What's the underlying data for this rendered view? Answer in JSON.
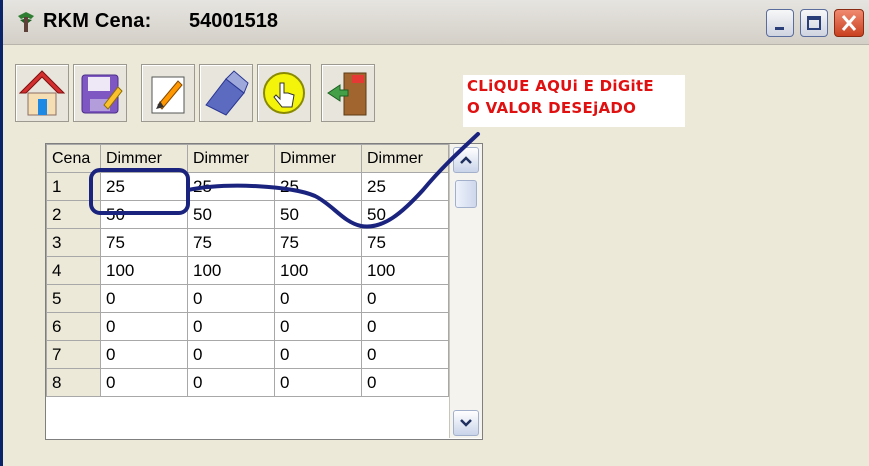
{
  "window": {
    "title_label": "RKM Cena:",
    "title_value": "54001518",
    "controls": [
      "minimize-icon",
      "maximize-icon",
      "close-icon"
    ]
  },
  "toolbar": {
    "buttons": [
      "home-icon",
      "save-icon",
      "edit-icon",
      "clear-icon",
      "click-icon",
      "exit-icon"
    ]
  },
  "callout": {
    "line1": "CLiQUE AQUi E DiGitE",
    "line2": "O VALOR DESEjADO",
    "color": "#e01010"
  },
  "grid": {
    "headers": [
      "Cena",
      "Dimmer",
      "Dimmer",
      "Dimmer",
      "Dimmer"
    ],
    "rows": [
      [
        "1",
        "25",
        "25",
        "25",
        "25"
      ],
      [
        "2",
        "50",
        "50",
        "50",
        "50"
      ],
      [
        "3",
        "75",
        "75",
        "75",
        "75"
      ],
      [
        "4",
        "100",
        "100",
        "100",
        "100"
      ],
      [
        "5",
        "0",
        "0",
        "0",
        "0"
      ],
      [
        "6",
        "0",
        "0",
        "0",
        "0"
      ],
      [
        "7",
        "0",
        "0",
        "0",
        "0"
      ],
      [
        "8",
        "0",
        "0",
        "0",
        "0"
      ]
    ],
    "highlighted_cell": "row 1, first Dimmer column"
  },
  "annotation_color": "#1a237e"
}
